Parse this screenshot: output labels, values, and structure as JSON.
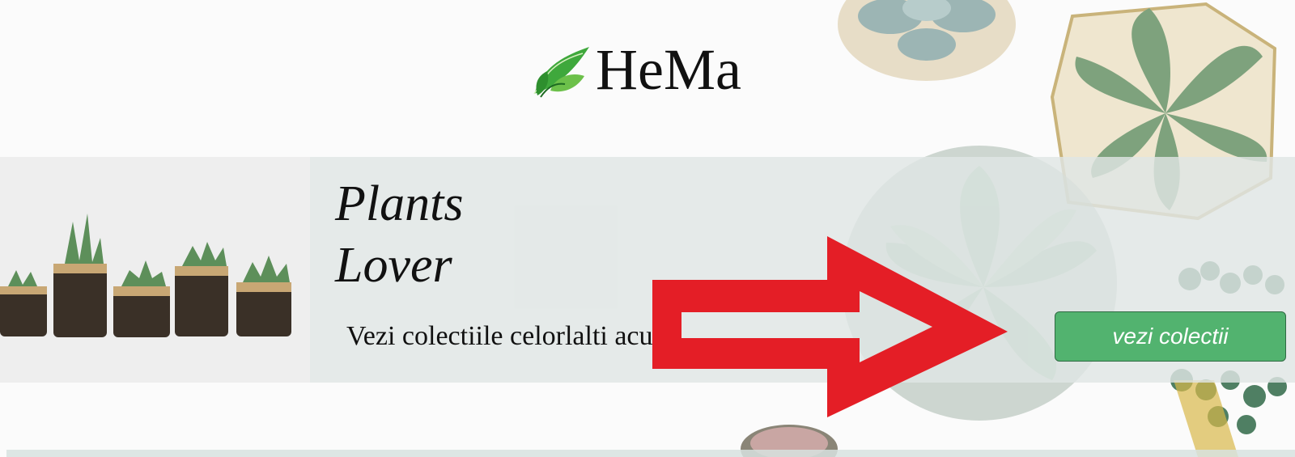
{
  "logo": {
    "text": "HeMa",
    "icon": "leaf-icon"
  },
  "banner": {
    "title_line1": "Plants",
    "title_line2": "Lover",
    "subtitle": "Vezi colectiile celorlalti acum",
    "button_label": "vezi colectii"
  },
  "annotation": {
    "icon": "red-arrow-icon",
    "color": "#e41e26"
  },
  "colors": {
    "button_green": "#52b36f",
    "arrow_red": "#e41e26"
  }
}
